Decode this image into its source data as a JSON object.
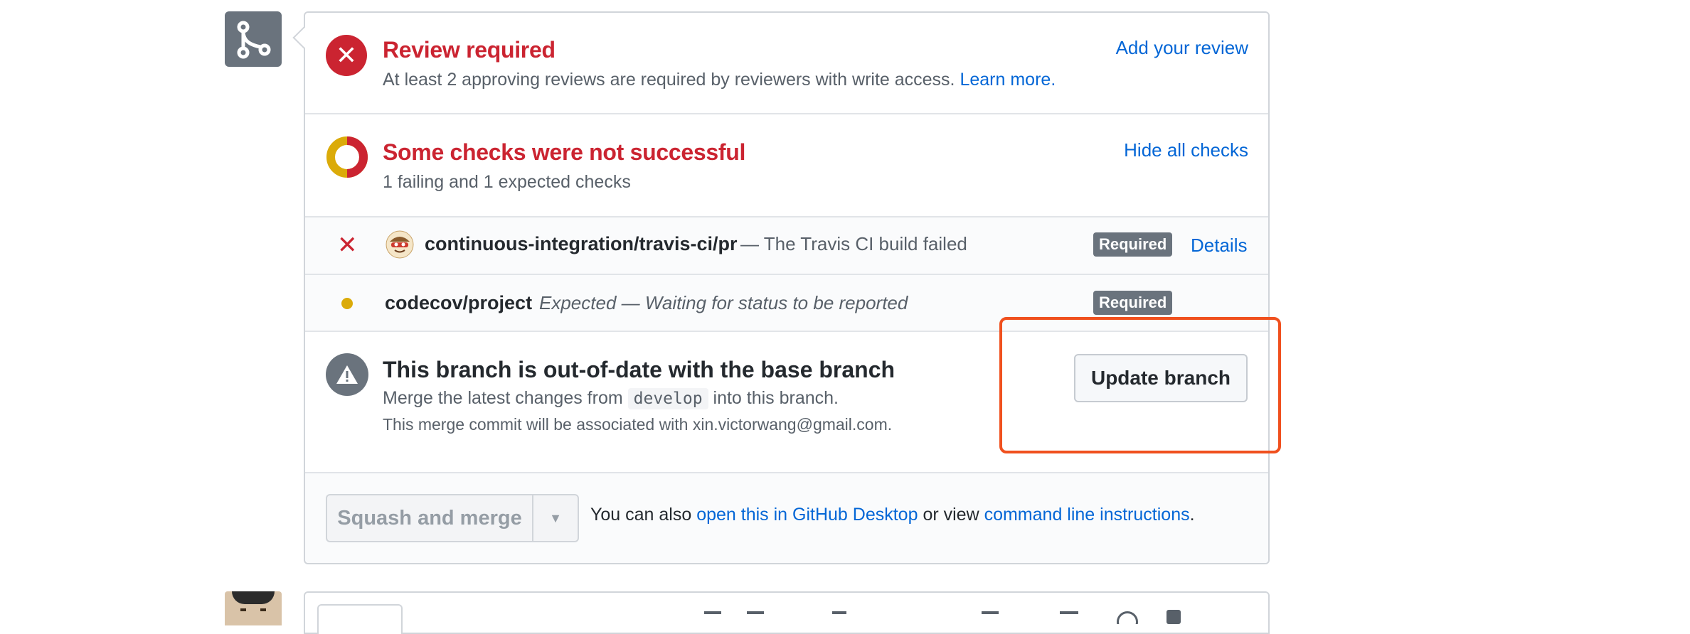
{
  "review": {
    "title": "Review required",
    "desc": "At least 2 approving reviews are required by reviewers with write access.",
    "learn_more": "Learn more.",
    "add_review": "Add your review"
  },
  "checks": {
    "title": "Some checks were not successful",
    "desc": "1 failing and 1 expected checks",
    "hide_all": "Hide all checks",
    "items": [
      {
        "name": "continuous-integration/travis-ci/pr",
        "desc": "— The Travis CI build failed",
        "badge": "Required",
        "action": "Details",
        "status": "failed"
      },
      {
        "name": "codecov/project",
        "desc": "Expected — Waiting for status to be reported",
        "badge": "Required",
        "status": "expected"
      }
    ]
  },
  "branch": {
    "title": "This branch is out-of-date with the base branch",
    "desc_before": "Merge the latest changes from",
    "base_branch": "develop",
    "desc_after": "into this branch.",
    "commit_note": "This merge commit will be associated with xin.victorwang@gmail.com.",
    "update_button": "Update branch"
  },
  "merge": {
    "button": "Squash and merge",
    "also_text": "You can also",
    "desktop_link": "open this in GitHub Desktop",
    "or_view": "or view",
    "cli_link": "command line instructions",
    "period": "."
  },
  "colors": {
    "error": "#cb2431",
    "pending": "#dbab09",
    "link": "#0366d6",
    "highlight": "#f0501e"
  }
}
